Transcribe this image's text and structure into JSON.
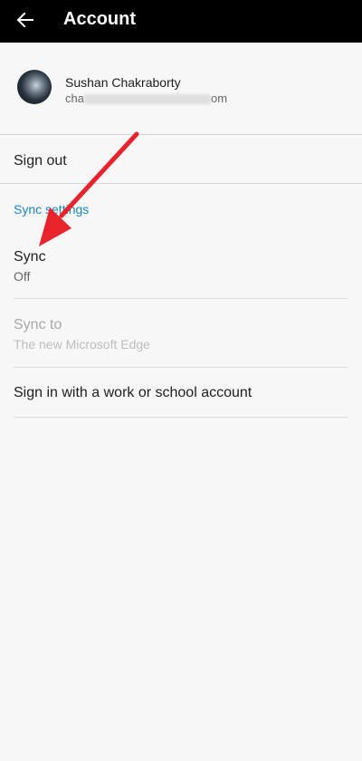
{
  "header": {
    "title": "Account",
    "back_icon": "back-arrow-icon",
    "background": "#000000"
  },
  "profile": {
    "name": "Sushan Chakraborty",
    "email_prefix": "cha",
    "email_suffix": "om"
  },
  "menu": {
    "sign_out": "Sign out",
    "section_header": "Sync settings",
    "sync": {
      "title": "Sync",
      "value": "Off"
    },
    "sync_to": {
      "title": "Sync to",
      "value": "The new Microsoft Edge"
    },
    "work_account": "Sign in with a work or school account"
  },
  "colors": {
    "accent": "#1a87c4",
    "annotation_arrow": "#e8232b"
  },
  "annotation": {
    "icon": "red-arrow-annotation-icon"
  }
}
